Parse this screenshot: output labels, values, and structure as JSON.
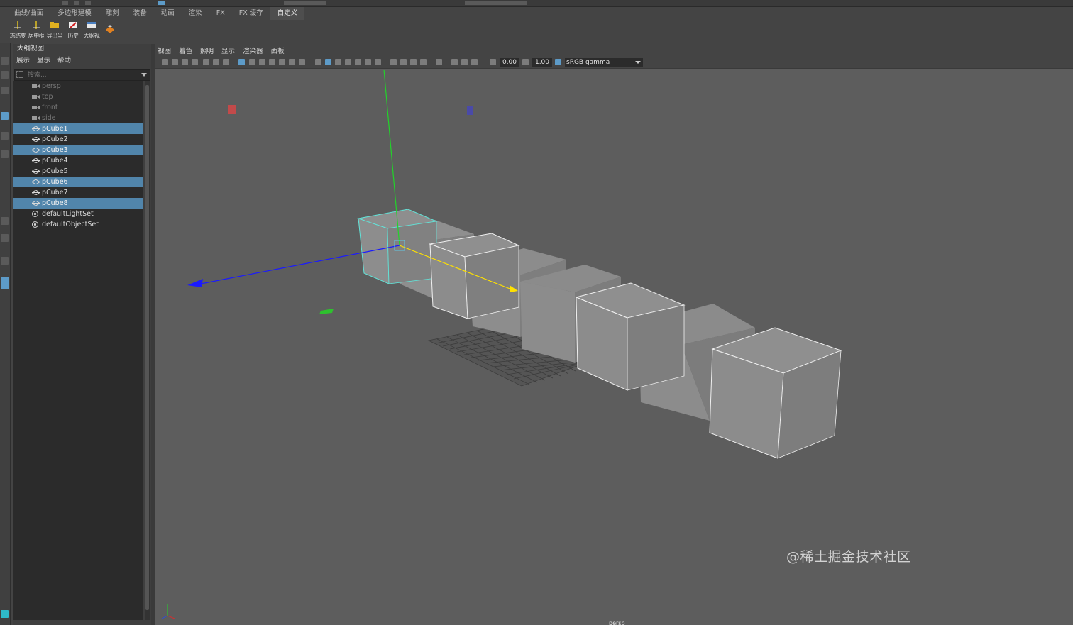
{
  "shelf_tabs": [
    "曲线/曲面",
    "多边形建模",
    "雕刻",
    "装备",
    "动画",
    "渲染",
    "FX",
    "FX 缓存",
    "自定义"
  ],
  "active_shelf_tab": "自定义",
  "shelf_buttons": [
    {
      "label": "冻结变",
      "icon": "freeze-transform-icon"
    },
    {
      "label": "居中枢",
      "icon": "center-pivot-icon"
    },
    {
      "label": "导出当",
      "icon": "export-folder-icon"
    },
    {
      "label": "历史",
      "icon": "delete-history-icon"
    },
    {
      "label": "大纲视",
      "icon": "outliner-icon"
    },
    {
      "label": "",
      "icon": "transform-gizmo-icon"
    }
  ],
  "outliner": {
    "title": "大纲视图",
    "menu": [
      "展示",
      "显示",
      "帮助"
    ],
    "search_placeholder": "搜索...",
    "items": [
      {
        "name": "persp",
        "type": "camera",
        "selected": false,
        "dim": true
      },
      {
        "name": "top",
        "type": "camera",
        "selected": false,
        "dim": true
      },
      {
        "name": "front",
        "type": "camera",
        "selected": false,
        "dim": true
      },
      {
        "name": "side",
        "type": "camera",
        "selected": false,
        "dim": true
      },
      {
        "name": "pCube1",
        "type": "mesh",
        "selected": true,
        "dim": false
      },
      {
        "name": "pCube2",
        "type": "mesh",
        "selected": false,
        "dim": false
      },
      {
        "name": "pCube3",
        "type": "mesh",
        "selected": true,
        "dim": false
      },
      {
        "name": "pCube4",
        "type": "mesh",
        "selected": false,
        "dim": false
      },
      {
        "name": "pCube5",
        "type": "mesh",
        "selected": false,
        "dim": false
      },
      {
        "name": "pCube6",
        "type": "mesh",
        "selected": true,
        "dim": false
      },
      {
        "name": "pCube7",
        "type": "mesh",
        "selected": false,
        "dim": false
      },
      {
        "name": "pCube8",
        "type": "mesh",
        "selected": true,
        "dim": false
      },
      {
        "name": "defaultLightSet",
        "type": "set",
        "selected": false,
        "dim": false
      },
      {
        "name": "defaultObjectSet",
        "type": "set",
        "selected": false,
        "dim": false
      }
    ]
  },
  "viewport": {
    "menu": [
      "视图",
      "着色",
      "照明",
      "显示",
      "渲染器",
      "面板"
    ],
    "exposure": "0.00",
    "gamma": "1.00",
    "color_space": "sRGB gamma",
    "camera_name": "persp"
  },
  "watermark": "@稀土掘金技术社区",
  "colors": {
    "selection": "#5185ab",
    "viewport_bg": "#5d5d5d",
    "axis_x": "#ffe100",
    "axis_y": "#22d32a",
    "axis_z": "#1a1aff",
    "highlight_cyan": "#62e3d8"
  }
}
